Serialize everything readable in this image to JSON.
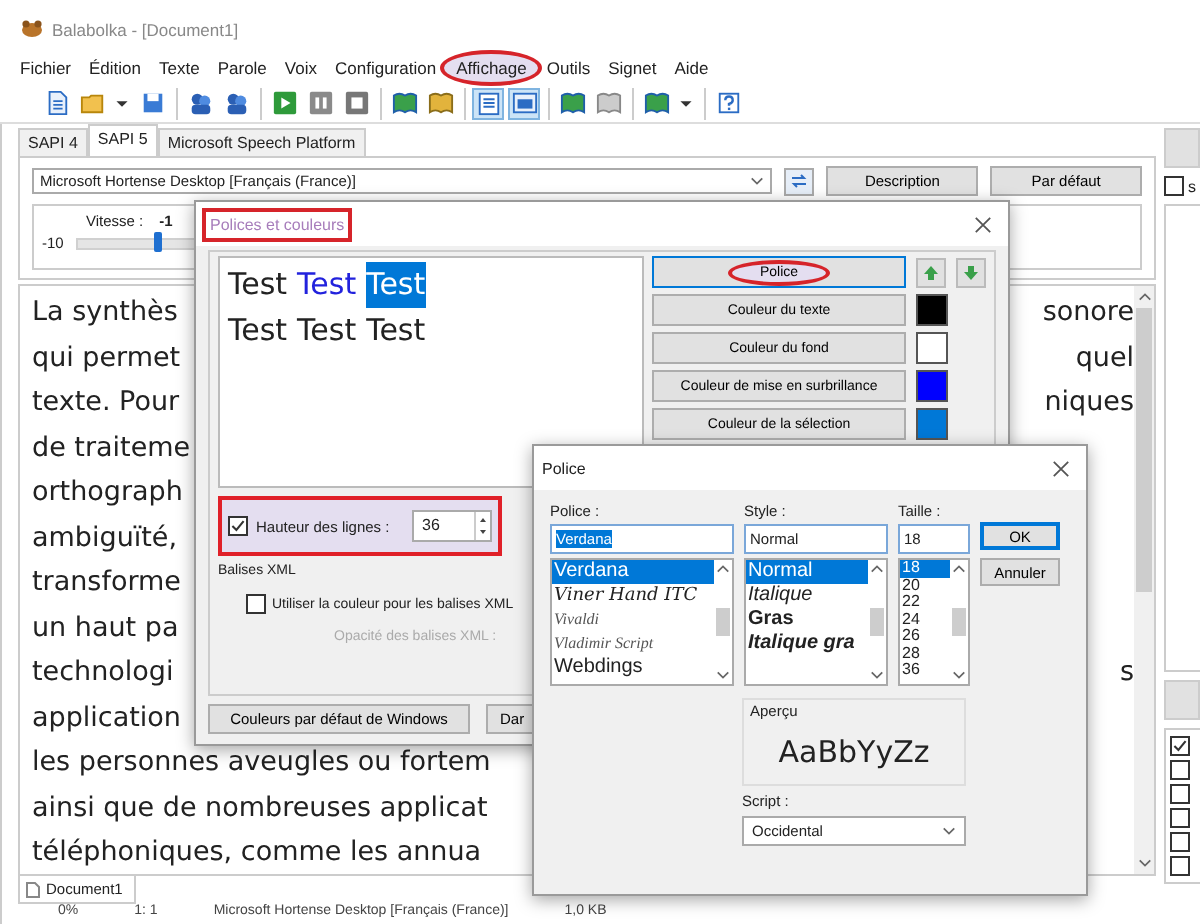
{
  "window": {
    "title": "Balabolka - [Document1]"
  },
  "menu": [
    {
      "label": "Fichier",
      "highlighted": false
    },
    {
      "label": "Édition",
      "highlighted": false
    },
    {
      "label": "Texte",
      "highlighted": false
    },
    {
      "label": "Parole",
      "highlighted": false
    },
    {
      "label": "Voix",
      "highlighted": false
    },
    {
      "label": "Configuration",
      "highlighted": false
    },
    {
      "label": "Affichage",
      "highlighted": true
    },
    {
      "label": "Outils",
      "highlighted": false
    },
    {
      "label": "Signet",
      "highlighted": false
    },
    {
      "label": "Aide",
      "highlighted": false
    }
  ],
  "toolbar": [
    [
      {
        "kind": "page",
        "pressed": false
      },
      {
        "kind": "folder",
        "pressed": false
      },
      {
        "kind": "caret",
        "pressed": false
      },
      {
        "kind": "disk",
        "pressed": false
      }
    ],
    [
      {
        "kind": "people",
        "pressed": false
      },
      {
        "kind": "people",
        "pressed": false
      }
    ],
    [
      {
        "kind": "play",
        "pressed": false
      },
      {
        "kind": "pause",
        "pressed": false
      },
      {
        "kind": "stop",
        "pressed": false
      }
    ],
    [
      {
        "kind": "book",
        "pressed": false
      },
      {
        "kind": "lockbook",
        "pressed": false
      }
    ],
    [
      {
        "kind": "note",
        "pressed": true
      },
      {
        "kind": "window",
        "pressed": true
      }
    ],
    [
      {
        "kind": "book",
        "pressed": false
      },
      {
        "kind": "graybook",
        "pressed": false
      }
    ],
    [
      {
        "kind": "book",
        "pressed": false
      },
      {
        "kind": "caret",
        "pressed": false
      }
    ],
    [
      {
        "kind": "help",
        "pressed": false
      }
    ]
  ],
  "engine_tabs": [
    {
      "label": "SAPI 4",
      "selected": false
    },
    {
      "label": "SAPI 5",
      "selected": true
    },
    {
      "label": "Microsoft Speech Platform",
      "selected": false
    }
  ],
  "voice": {
    "value": "Microsoft Hortense Desktop [Français (France)]"
  },
  "voice_buttons": [
    "Description",
    "Par défaut"
  ],
  "rate": {
    "label": "Vitesse :",
    "value": "-1",
    "min_label": "-10",
    "level": 0.45
  },
  "text_lines": [
    {
      "left": "La synthès",
      "right": "sonore"
    },
    {
      "left": "qui permet",
      "right": "quel"
    },
    {
      "left": "texte. Pour",
      "right": "niques"
    },
    {
      "left": "de traiteme"
    },
    {
      "left": "orthograph"
    },
    {
      "left": "ambiguïté,"
    },
    {
      "left": "transforme"
    },
    {
      "left": "un haut pa"
    },
    {
      "left": "technologi",
      "right": "s"
    },
    {
      "left": "application"
    },
    {
      "left": "les personnes aveugles ou fortem"
    },
    {
      "left": "ainsi que de nombreuses applicat"
    },
    {
      "left": "téléphoniques, comme les annua"
    }
  ],
  "document_tabs": [
    {
      "label": "Document1",
      "selected": true
    }
  ],
  "status_bar": [
    "0%",
    "1: 1",
    "Microsoft Hortense Desktop [Français (France)]",
    "1,0 KB"
  ],
  "right_panel": {
    "top_checks": [
      {
        "label": "s",
        "checked": false
      }
    ],
    "checks": [
      {
        "checked": true
      },
      {
        "checked": false
      },
      {
        "checked": false
      },
      {
        "checked": false
      },
      {
        "checked": false
      },
      {
        "checked": false
      }
    ]
  },
  "colors_dialog": {
    "title": "Polices et couleurs",
    "title_highlighted": true,
    "preview_lines": [
      [
        {
          "text": "Test",
          "kind": "normal"
        },
        {
          "text": "Test",
          "kind": "highlight"
        },
        {
          "text": "Test",
          "kind": "selection"
        }
      ],
      [
        {
          "text": "Test",
          "kind": "normal"
        },
        {
          "text": "Test",
          "kind": "normal"
        },
        {
          "text": "Test",
          "kind": "normal"
        }
      ]
    ],
    "buttons": [
      {
        "label": "Police",
        "kind": "font",
        "highlighted": true
      },
      {
        "label": "Couleur du texte",
        "kind": "color",
        "color": "#000000",
        "highlighted": false
      },
      {
        "label": "Couleur du fond",
        "kind": "color",
        "color": "#ffffff",
        "highlighted": false
      },
      {
        "label": "Couleur de mise en surbrillance",
        "kind": "color",
        "color": "#0000ff",
        "highlighted": false
      },
      {
        "label": "Couleur de la sélection",
        "kind": "color",
        "color": "#0078d7",
        "highlighted": false
      }
    ],
    "line_height": {
      "label": "Hauteur des lignes :",
      "checked": true,
      "value": "36",
      "highlighted": true
    },
    "xml_group": {
      "title": "Balises XML",
      "checkbox": {
        "label": "Utiliser la couleur pour les balises XML",
        "checked": false
      },
      "opacity_label": "Opacité des balises XML :",
      "opacity_disabled": true
    },
    "bottom_buttons": [
      "Couleurs par défaut de Windows",
      "Dar"
    ]
  },
  "font_dialog": {
    "title": "Police",
    "font": {
      "label": "Police :",
      "value": "Verdana",
      "items": [
        {
          "label": "Verdana",
          "kind": "sans",
          "selected": true
        },
        {
          "label": "Viner Hand ITC",
          "kind": "script",
          "selected": false
        },
        {
          "label": "Vivaldi",
          "kind": "thin-script",
          "selected": false
        },
        {
          "label": "Vladimir Script",
          "kind": "thin-script",
          "selected": false
        },
        {
          "label": "Webdings",
          "kind": "sans",
          "selected": false
        }
      ]
    },
    "style": {
      "label": "Style :",
      "value": "Normal",
      "items": [
        {
          "label": "Normal",
          "kind": "normal",
          "selected": true
        },
        {
          "label": "Italique",
          "kind": "italic",
          "selected": false
        },
        {
          "label": "Gras",
          "kind": "bold",
          "selected": false
        },
        {
          "label": "Italique gra",
          "kind": "bold-italic",
          "selected": false
        }
      ]
    },
    "size": {
      "label": "Taille :",
      "value": "18",
      "items": [
        {
          "label": "18",
          "selected": true
        },
        {
          "label": "20",
          "selected": false
        },
        {
          "label": "22",
          "selected": false
        },
        {
          "label": "24",
          "selected": false
        },
        {
          "label": "26",
          "selected": false
        },
        {
          "label": "28",
          "selected": false
        },
        {
          "label": "36",
          "selected": false
        }
      ]
    },
    "buttons": [
      "OK",
      "Annuler"
    ],
    "preview": {
      "title": "Aperçu",
      "sample": "AaBbYyZz"
    },
    "script": {
      "label": "Script :",
      "value": "Occidental"
    }
  }
}
